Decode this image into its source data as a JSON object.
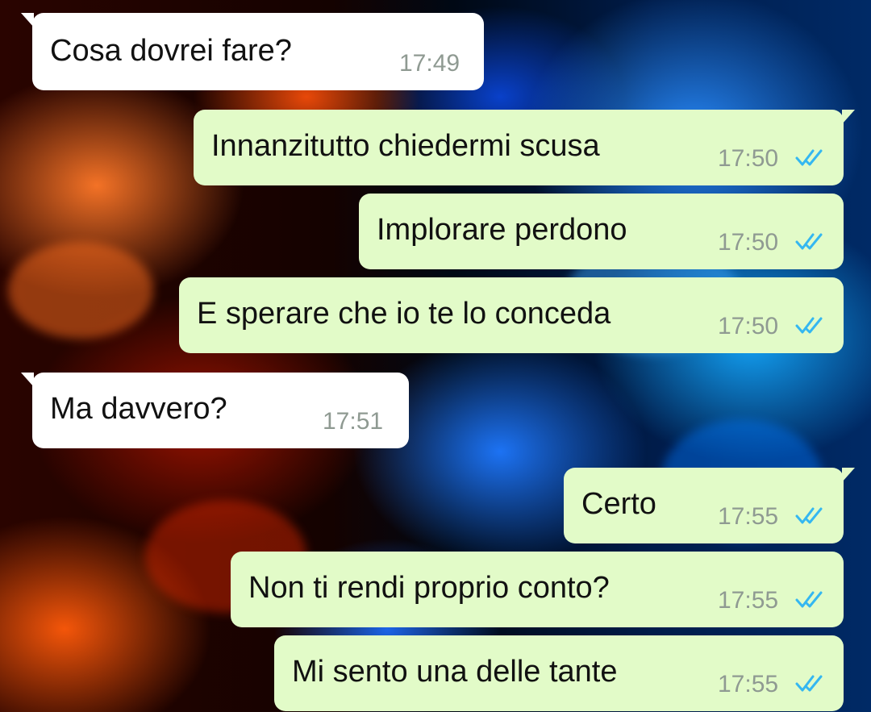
{
  "chat": {
    "wallpaper": "red-blue-fire",
    "colors": {
      "incoming_bubble": "#ffffff",
      "outgoing_bubble": "#e2fbc8",
      "read_ticks": "#34b7f1",
      "timestamp": "#8f9a92"
    },
    "messages": [
      {
        "direction": "incoming",
        "text": "Cosa dovrei fare?",
        "time": "17:49"
      },
      {
        "direction": "outgoing",
        "text": "Innanzitutto chiedermi scusa",
        "time": "17:50",
        "status": "read-double-check-icon"
      },
      {
        "direction": "outgoing",
        "text": "Implorare perdono",
        "time": "17:50",
        "status": "read-double-check-icon"
      },
      {
        "direction": "outgoing",
        "text": "E sperare che io te lo conceda",
        "time": "17:50",
        "status": "read-double-check-icon"
      },
      {
        "direction": "incoming",
        "text": "Ma davvero?",
        "time": "17:51"
      },
      {
        "direction": "outgoing",
        "text": "Certo",
        "time": "17:55",
        "status": "read-double-check-icon"
      },
      {
        "direction": "outgoing",
        "text": "Non ti rendi proprio conto?",
        "time": "17:55",
        "status": "read-double-check-icon"
      },
      {
        "direction": "outgoing",
        "text": "Mi sento una delle tante",
        "time": "17:55",
        "status": "read-double-check-icon"
      }
    ]
  }
}
